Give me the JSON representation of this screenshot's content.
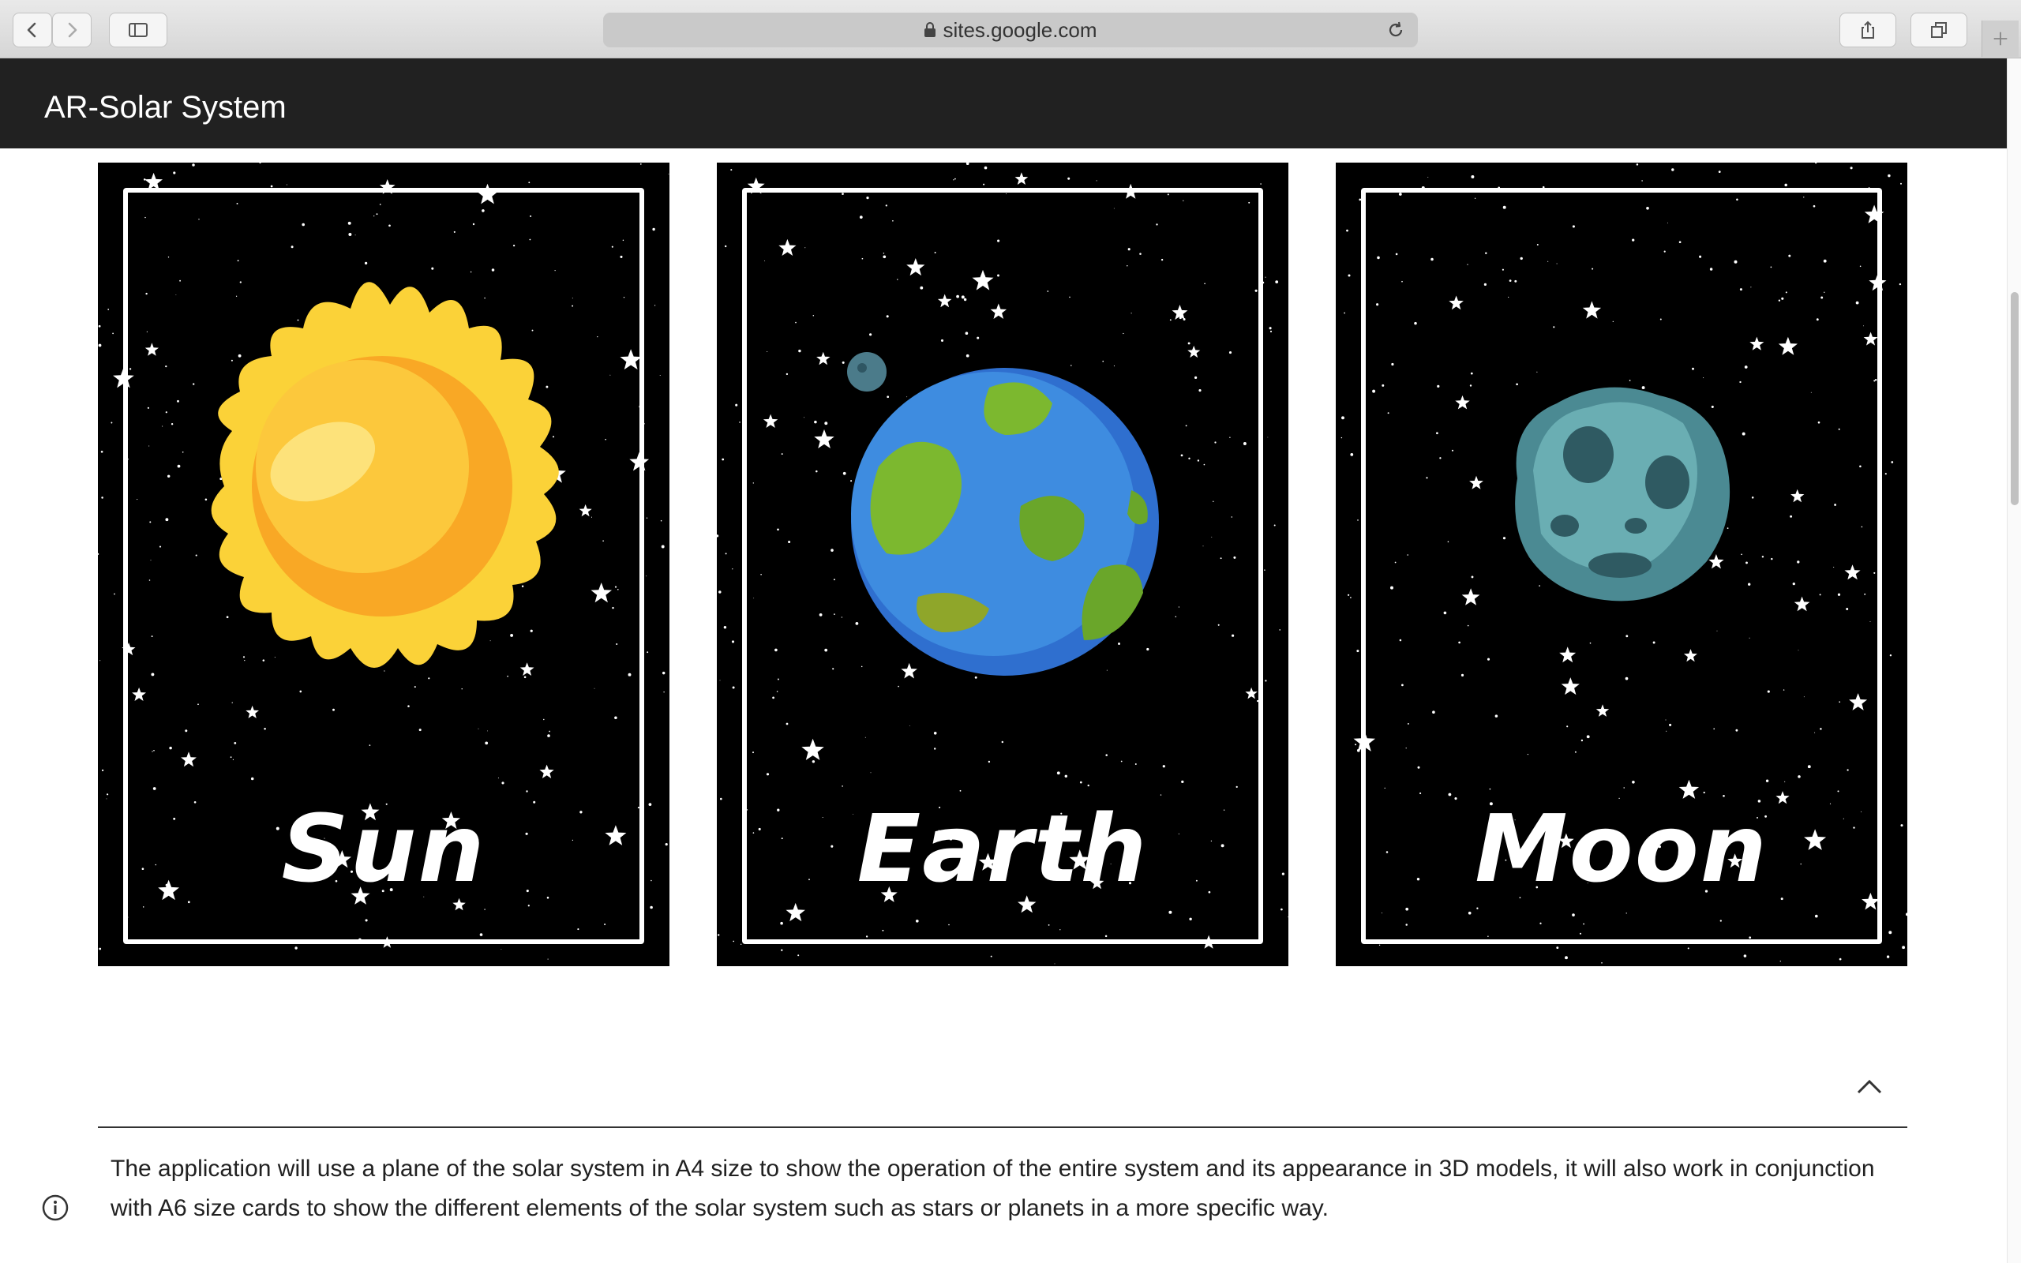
{
  "browser": {
    "url": "sites.google.com"
  },
  "site": {
    "title": "AR-Solar System"
  },
  "cards": [
    {
      "label": "Sun"
    },
    {
      "label": "Earth"
    },
    {
      "label": "Moon"
    }
  ],
  "description": "The application will use a plane of the solar system in A4 size to show the operation of the entire system and its appearance in 3D models, it will also work in conjunction with A6 size cards to show the different elements of the solar system such as stars or planets in a more specific way.",
  "icons": {
    "back": "chevron-left-icon",
    "forward": "chevron-right-icon",
    "sidebar": "sidebar-icon",
    "lock": "lock-icon",
    "reload": "reload-icon",
    "share": "share-icon",
    "tabs": "tabs-icon",
    "new_tab": "plus-icon",
    "collapse": "chevron-up-icon",
    "info": "info-icon"
  }
}
